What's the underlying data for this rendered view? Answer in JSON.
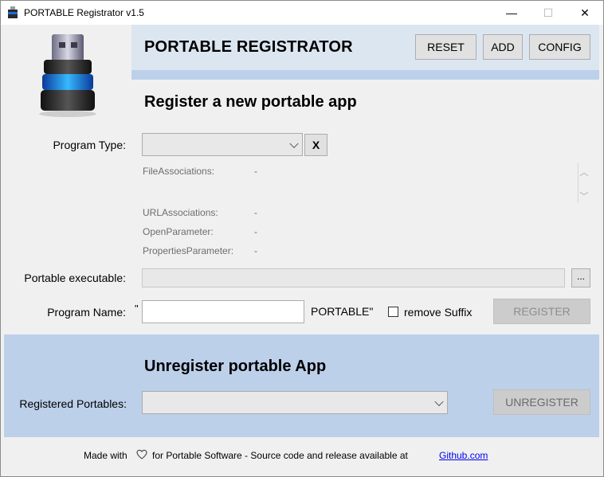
{
  "window": {
    "title": "PORTABLE Registrator v1.5",
    "minimize_glyph": "—",
    "maximize_glyph": "☐",
    "close_glyph": "✕"
  },
  "header": {
    "title": "PORTABLE REGISTRATOR",
    "reset_label": "RESET",
    "add_label": "ADD",
    "config_label": "CONFIG"
  },
  "register": {
    "section_title": "Register a new portable app",
    "program_type_label": "Program Type:",
    "program_type_value": "",
    "clear_label": "X",
    "info": [
      {
        "key": "FileAssociations:",
        "value": "-"
      },
      {
        "key": "URLAssociations:",
        "value": "-"
      },
      {
        "key": "OpenParameter:",
        "value": "-"
      },
      {
        "key": "PropertiesParameter:",
        "value": "-"
      }
    ],
    "executable_label": "Portable executable:",
    "executable_value": "",
    "browse_label": "...",
    "program_name_label": "Program Name:",
    "open_quote": "\"",
    "program_name_value": "",
    "suffix_text": "PORTABLE\"",
    "remove_suffix_label": "remove Suffix",
    "remove_suffix_checked": false,
    "register_label": "REGISTER"
  },
  "unregister": {
    "section_title": "Unregister portable App",
    "registered_label": "Registered Portables:",
    "registered_value": "",
    "unregister_label": "UNREGISTER"
  },
  "footer": {
    "made_with": "Made with",
    "text": "for Portable Software - Source code and release available at",
    "link_text": "Github.com"
  },
  "colors": {
    "header_band": "#dce6f1",
    "accent_band": "#bcd0ea",
    "link": "#0000ee"
  },
  "icons": [
    "usb-stick-icon",
    "heart-icon",
    "chevron-down-icon",
    "scroll-up-icon",
    "scroll-down-icon"
  ]
}
